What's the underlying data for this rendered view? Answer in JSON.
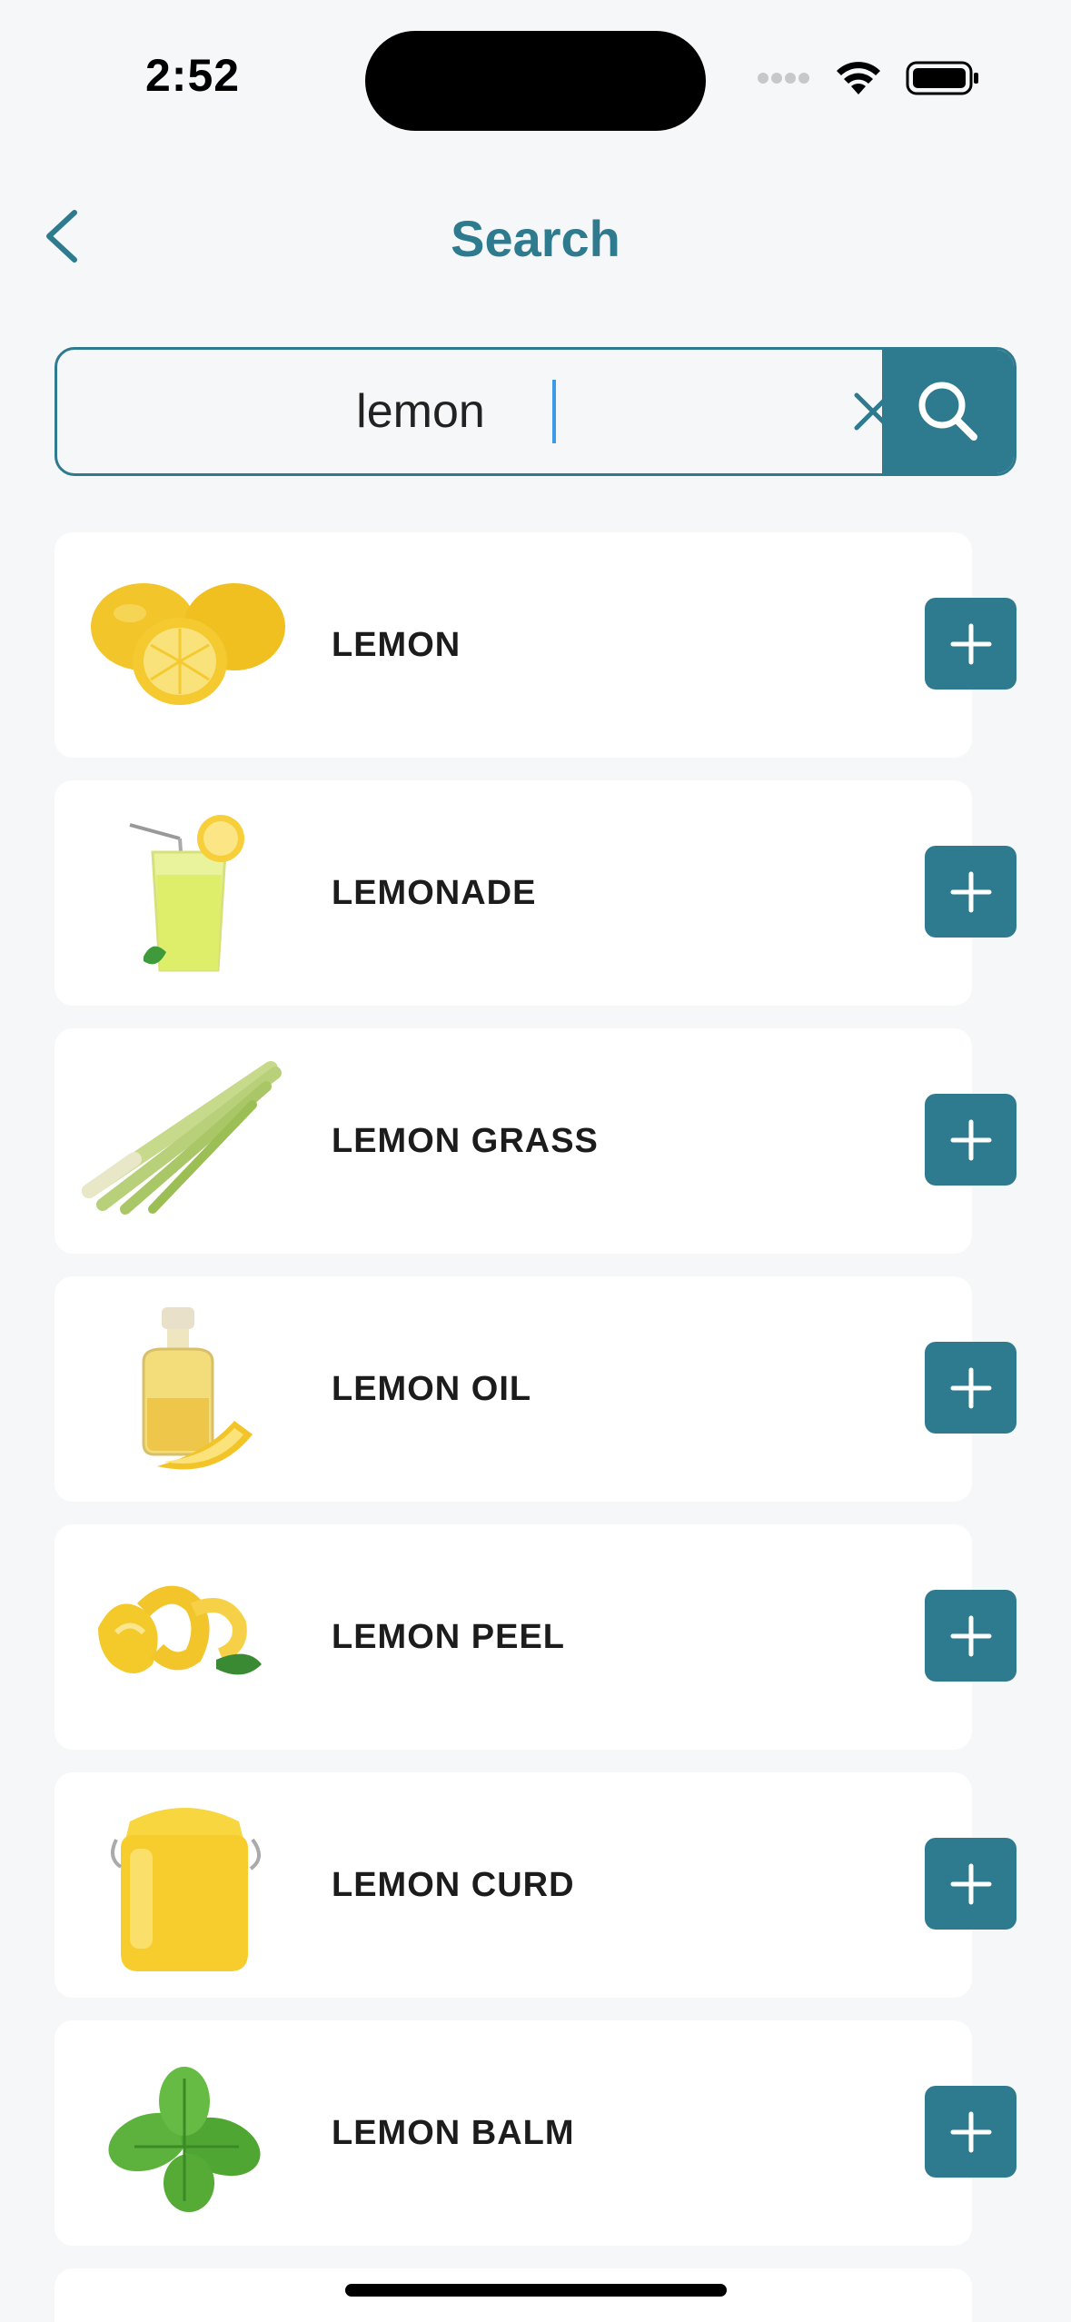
{
  "status_bar": {
    "time": "2:52"
  },
  "header": {
    "title": "Search"
  },
  "search": {
    "value": "lemon"
  },
  "results": [
    {
      "name": "LEMON",
      "icon": "lemon-image"
    },
    {
      "name": "LEMONADE",
      "icon": "lemonade-image"
    },
    {
      "name": "LEMON GRASS",
      "icon": "lemongrass-image"
    },
    {
      "name": "LEMON OIL",
      "icon": "lemon-oil-image"
    },
    {
      "name": "LEMON PEEL",
      "icon": "lemon-peel-image"
    },
    {
      "name": "LEMON CURD",
      "icon": "lemon-curd-image"
    },
    {
      "name": "LEMON BALM",
      "icon": "lemon-balm-image"
    }
  ],
  "colors": {
    "accent": "#2e7a8e",
    "background": "#f6f7f8",
    "card": "#ffffff"
  }
}
